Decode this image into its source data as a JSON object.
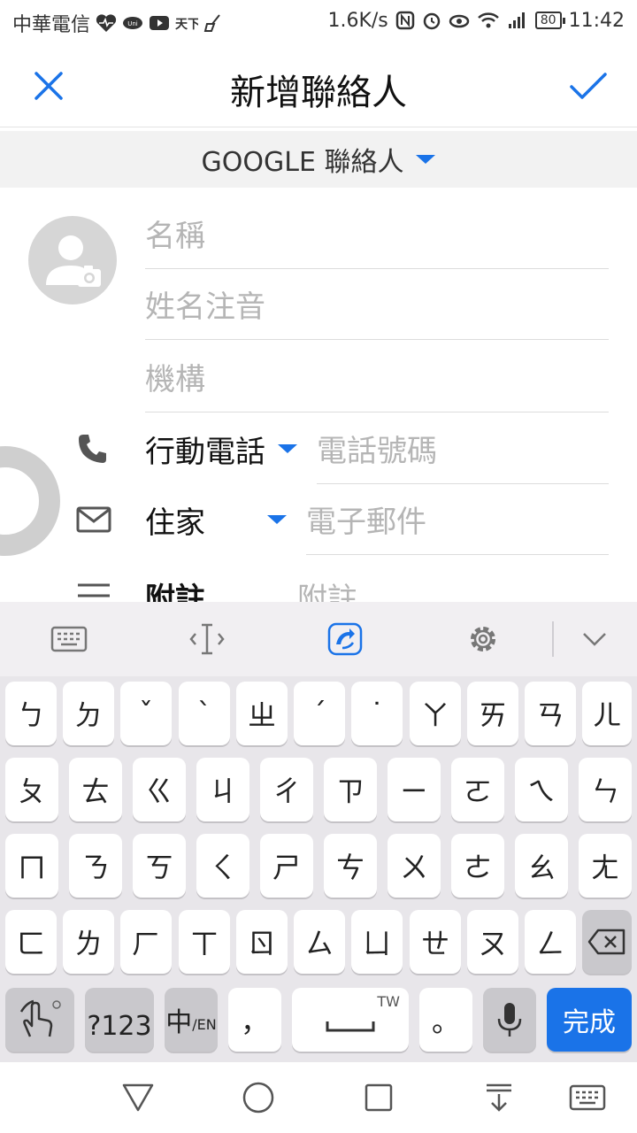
{
  "status_bar": {
    "carrier": "中華電信",
    "net_speed": "1.6K/s",
    "battery": "80",
    "time": "11:42",
    "icons": [
      "heart-rate-icon",
      "app-icon",
      "youtube-icon",
      "weather-icon",
      "broom-icon",
      "nfc-icon",
      "alarm-icon",
      "eye-icon",
      "wifi-icon",
      "signal-icon"
    ]
  },
  "app_bar": {
    "title": "新增聯絡人",
    "close_icon": "close-icon",
    "save_icon": "check-icon",
    "accent_color": "#1a73e8"
  },
  "account": {
    "label": "GOOGLE 聯絡人"
  },
  "form": {
    "name_placeholder": "名稱",
    "phonetic_placeholder": "姓名注音",
    "org_placeholder": "機構",
    "phone": {
      "type": "行動電話",
      "placeholder": "電話號碼"
    },
    "email": {
      "type": "住家",
      "placeholder": "電子郵件"
    },
    "note": {
      "type": "附註",
      "placeholder": "附註"
    }
  },
  "keyboard": {
    "rows": [
      [
        "ㄅ",
        "ㄉ",
        "ˇ",
        "ˋ",
        "ㄓ",
        "ˊ",
        "˙",
        "ㄚ",
        "ㄞ",
        "ㄢ",
        "ㄦ"
      ],
      [
        "ㄆ",
        "ㄊ",
        "ㄍ",
        "ㄐ",
        "ㄔ",
        "ㄗ",
        "ㄧ",
        "ㄛ",
        "ㄟ",
        "ㄣ"
      ],
      [
        "ㄇ",
        "ㄋ",
        "ㄎ",
        "ㄑ",
        "ㄕ",
        "ㄘ",
        "ㄨ",
        "ㄜ",
        "ㄠ",
        "ㄤ"
      ],
      [
        "ㄈ",
        "ㄌ",
        "ㄏ",
        "ㄒ",
        "ㄖ",
        "ㄙ",
        "ㄩ",
        "ㄝ",
        "ㄡ",
        "ㄥ"
      ]
    ],
    "symbols_label": "?123",
    "lang_label_main": "中",
    "lang_label_sub": "/EN",
    "comma": "，",
    "space_hint": "TW",
    "period": "。",
    "done_label": "完成"
  }
}
